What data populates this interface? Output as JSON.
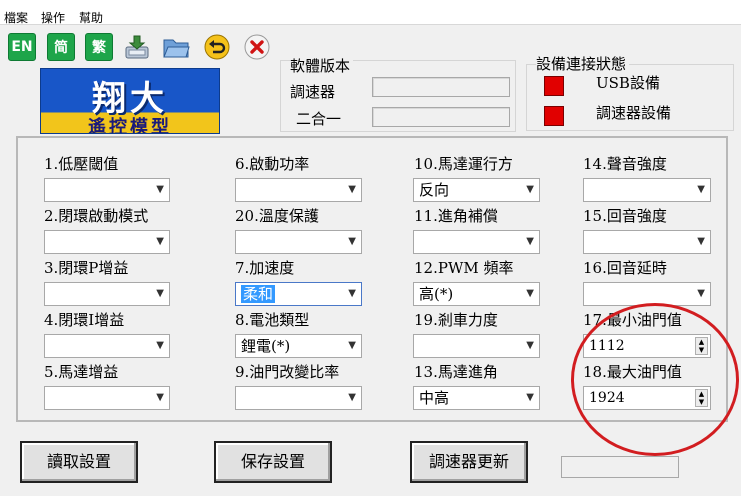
{
  "menu": {
    "file": "檔案",
    "ops": "操作",
    "help": "幫助"
  },
  "toolbar": {
    "en": "EN",
    "simplified": "简",
    "traditional": "繁"
  },
  "logo": {
    "line1": "翔大",
    "line2": "遙控模型"
  },
  "version": {
    "title": "軟體版本",
    "esc_label": "調速器",
    "combo_label": "二合一"
  },
  "device": {
    "title": "設備連接狀態",
    "usb_label": "USB設備",
    "esc_label": "調速器設備",
    "led_color": "#e10000"
  },
  "params": [
    {
      "label": "1.低壓閾值",
      "value": ""
    },
    {
      "label": "6.啟動功率",
      "value": ""
    },
    {
      "label": "10.馬達運行方",
      "value": "反向"
    },
    {
      "label": "14.聲音強度",
      "value": ""
    },
    {
      "label": "2.閉環啟動模式",
      "value": ""
    },
    {
      "label": "20.溫度保護",
      "value": ""
    },
    {
      "label": "11.進角補償",
      "value": ""
    },
    {
      "label": "15.回音強度",
      "value": ""
    },
    {
      "label": "3.閉環P增益",
      "value": ""
    },
    {
      "label": "7.加速度",
      "value": "柔和"
    },
    {
      "label": "12.PWM 頻率",
      "value": "高(*)"
    },
    {
      "label": "16.回音延時",
      "value": ""
    },
    {
      "label": "4.閉環I增益",
      "value": ""
    },
    {
      "label": "8.電池類型",
      "value": "鋰電(*)"
    },
    {
      "label": "19.剎車力度",
      "value": ""
    },
    {
      "label": "17.最小油門值",
      "value": "1112"
    },
    {
      "label": "5.馬達增益",
      "value": ""
    },
    {
      "label": "9.油門改變比率",
      "value": ""
    },
    {
      "label": "13.馬達進角",
      "value": "中高"
    },
    {
      "label": "18.最大油門值",
      "value": "1924"
    }
  ],
  "buttons": {
    "read": "讀取設置",
    "save": "保存設置",
    "update": "調速器更新"
  },
  "colors": {
    "annotation_circle": "#d21d20",
    "highlight": "#3399ff"
  }
}
